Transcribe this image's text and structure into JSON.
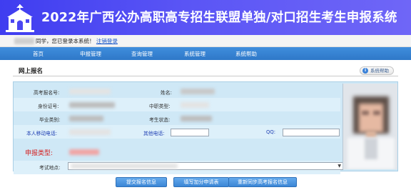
{
  "header": {
    "title": "2022年广西公办高职高专招生联盟单独/对口招生考生申报系统",
    "logo_icon": "school-building-icon"
  },
  "userbar": {
    "greeting": "同学，您已登录本系统！",
    "logout_label": "注销登录"
  },
  "nav": {
    "items": [
      "首页",
      "申报管理",
      "查询管理",
      "系统管理",
      "系统帮助"
    ]
  },
  "panel": {
    "title": "网上报名",
    "help_label": "系统帮助"
  },
  "form": {
    "exam_no_label": "高考报名号:",
    "name_label": "姓名:",
    "id_no_label": "身份证号:",
    "secondary_type_label": "中职类型:",
    "grad_category_label": "毕业类别:",
    "candidate_status_label": "考生状态:",
    "mobile_label": "本人移动电话:",
    "other_phone_label": "其他电话:",
    "qq_label": "QQ:",
    "apply_type_label": "申报类型:",
    "exam_site_label": "考试地点:",
    "other_phone_value": "",
    "qq_value": ""
  },
  "buttons": {
    "submit": "提交报名信息",
    "bonus": "填写加分申请表",
    "resync": "重新同步高考报名信息"
  },
  "colors": {
    "header_bg": "#4b46f2",
    "nav_bg": "#3584d2",
    "form_bg": "#cfe8f6",
    "label_blue": "#1f3fb3",
    "label_red": "#d42020"
  }
}
